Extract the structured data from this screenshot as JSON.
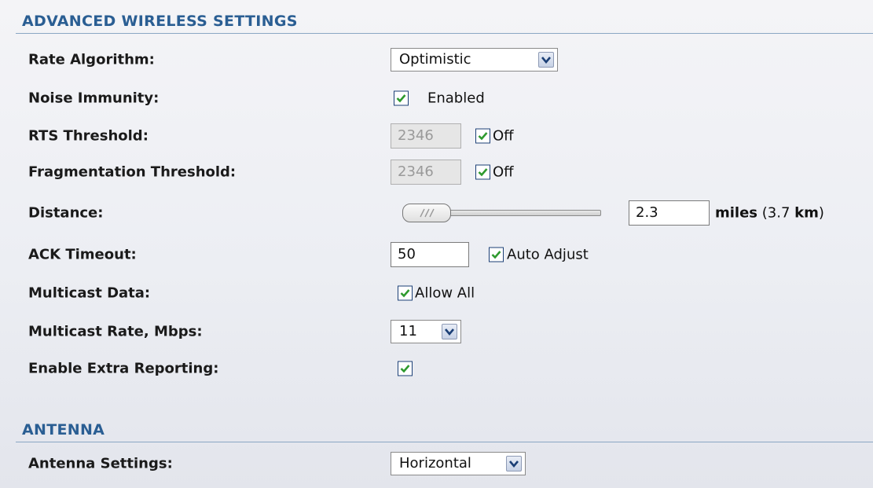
{
  "advanced": {
    "title": "ADVANCED WIRELESS SETTINGS",
    "rate_algorithm": {
      "label": "Rate Algorithm:",
      "value": "Optimistic"
    },
    "noise_immunity": {
      "label": "Noise Immunity:",
      "checked": true,
      "checkbox_label": "Enabled"
    },
    "rts_threshold": {
      "label": "RTS Threshold:",
      "value": "2346",
      "disabled": true,
      "checked": true,
      "checkbox_label": "Off"
    },
    "fragmentation_threshold": {
      "label": "Fragmentation Threshold:",
      "value": "2346",
      "disabled": true,
      "checked": true,
      "checkbox_label": "Off"
    },
    "distance": {
      "label": "Distance:",
      "slider_level": 0.0,
      "value": "2.3",
      "unit": "miles",
      "metric": "(3.7",
      "metric_unit": "km",
      "metric_close": ")"
    },
    "ack_timeout": {
      "label": "ACK Timeout:",
      "value": "50",
      "checked": true,
      "checkbox_label": "Auto Adjust"
    },
    "multicast_data": {
      "label": "Multicast Data:",
      "checked": true,
      "checkbox_label": "Allow All"
    },
    "multicast_rate": {
      "label": "Multicast Rate, Mbps:",
      "value": "11"
    },
    "extra_reporting": {
      "label": "Enable Extra Reporting:",
      "checked": true
    }
  },
  "antenna": {
    "title": "ANTENNA",
    "settings": {
      "label": "Antenna Settings:",
      "value": "Horizontal"
    }
  },
  "colors": {
    "section_title": "#2a5e93",
    "section_rule": "#8aa6c3",
    "checkmark": "#2e9a2e"
  },
  "icons": {
    "dropdown": "chevron-down-icon",
    "check": "checkmark-icon",
    "slider_grip": "grip-lines-icon"
  }
}
